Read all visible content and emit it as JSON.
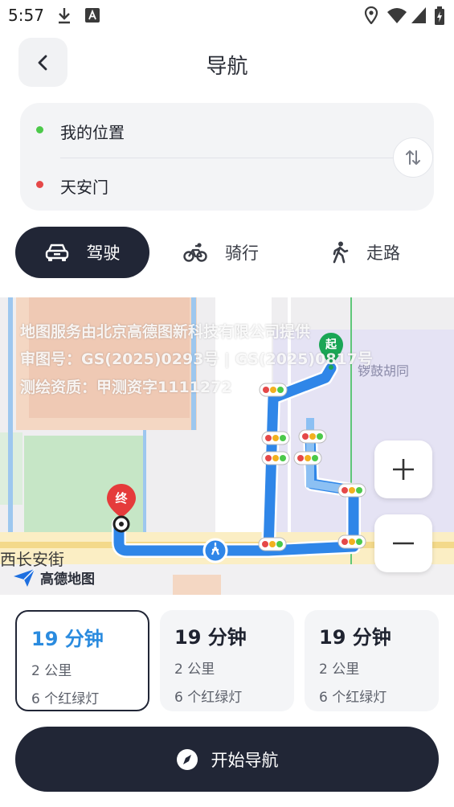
{
  "status_bar": {
    "time": "5:57"
  },
  "header": {
    "title": "导航"
  },
  "route": {
    "origin": "我的位置",
    "destination": "天安门"
  },
  "modes": [
    {
      "label": "驾驶",
      "icon": "car-icon",
      "active": true
    },
    {
      "label": "骑行",
      "icon": "bike-icon",
      "active": false
    },
    {
      "label": "走路",
      "icon": "walk-icon",
      "active": false
    }
  ],
  "map": {
    "watermark": [
      "地图服务由北京高德图新科技有限公司提供",
      "审图号：GS(2025)0293号 | GS(2025)0817号",
      "测绘资质：甲测资字1111272"
    ],
    "start_marker": "起",
    "end_marker": "终",
    "street_label": "西长安街",
    "poi_label": "锣鼓胡同",
    "logo_text": "高德地图"
  },
  "options": [
    {
      "time": "19 分钟",
      "distance": "2 公里",
      "lights": "6 个红绿灯",
      "selected": true
    },
    {
      "time": "19 分钟",
      "distance": "2 公里",
      "lights": "6 个红绿灯",
      "selected": false
    },
    {
      "time": "19 分钟",
      "distance": "2 公里",
      "lights": "6 个红绿灯",
      "selected": false
    }
  ],
  "actions": {
    "start_label": "开始导航"
  },
  "colors": {
    "accent_dark": "#212636",
    "accent_blue": "#2a8bdf",
    "route_blue": "#2f86e8",
    "origin_green": "#4cc94a",
    "destination_red": "#e54848"
  }
}
